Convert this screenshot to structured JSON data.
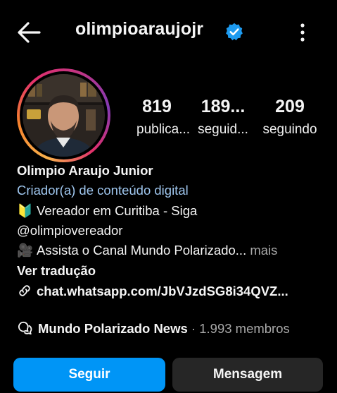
{
  "header": {
    "username": "olimpioaraujojr",
    "back_icon": "arrow-left-icon",
    "verified_icon": "verified-badge-icon",
    "more_icon": "vertical-dots-icon"
  },
  "profile": {
    "avatar_icon": "profile-photo"
  },
  "stats": [
    {
      "value": "819",
      "label": "publica..."
    },
    {
      "value": "189...",
      "label": "seguid..."
    },
    {
      "value": "209",
      "label": "seguindo"
    }
  ],
  "bio": {
    "name": "Olimpio Araujo Junior",
    "category": "Criador(a) de conteúdo digital",
    "line1_emoji": "🔰",
    "line1": "Vereador em Curitiba - Siga",
    "line2": "@olimpiovereador",
    "line3_emoji": "🎥",
    "line3": "Assista o Canal Mundo Polarizado...",
    "more": " mais",
    "translate": "Ver tradução",
    "link_icon": "link-icon",
    "link": "chat.whatsapp.com/JbVJzdSG8i34QVZ..."
  },
  "community": {
    "icon": "chat-bubbles-icon",
    "name": "Mundo Polarizado News",
    "meta": " · 1.993 membros"
  },
  "actions": {
    "follow": "Seguir",
    "message": "Mensagem"
  },
  "colors": {
    "background": "#000000",
    "accent": "#0095f6",
    "secondary_button": "#262626",
    "category_text": "#9fc6ee",
    "muted_text": "#a8a8a8"
  }
}
